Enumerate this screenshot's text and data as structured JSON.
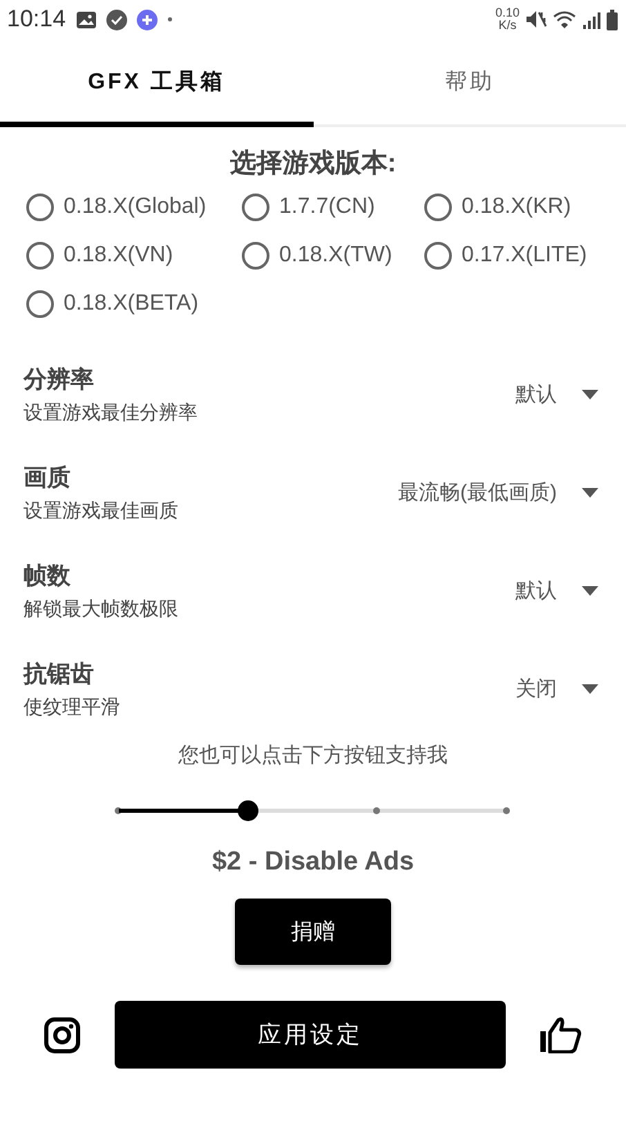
{
  "status_bar": {
    "time": "10:14",
    "net_speed": "0.10",
    "net_unit": "K/s"
  },
  "tabs": [
    {
      "label": "GFX 工具箱",
      "selected": true
    },
    {
      "label": "帮助",
      "selected": false
    }
  ],
  "version_picker": {
    "title": "选择游戏版本:",
    "options": [
      {
        "label": "0.18.X(Global)",
        "selected": false
      },
      {
        "label": "1.7.7(CN)",
        "selected": false
      },
      {
        "label": "0.18.X(KR)",
        "selected": false
      },
      {
        "label": "0.18.X(VN)",
        "selected": false
      },
      {
        "label": "0.18.X(TW)",
        "selected": false
      },
      {
        "label": "0.17.X(LITE)",
        "selected": false
      },
      {
        "label": "0.18.X(BETA)",
        "selected": false
      }
    ]
  },
  "settings": [
    {
      "title": "分辨率",
      "subtitle": "设置游戏最佳分辨率",
      "value": "默认"
    },
    {
      "title": "画质",
      "subtitle": "设置游戏最佳画质",
      "value": "最流畅(最低画质)"
    },
    {
      "title": "帧数",
      "subtitle": "解锁最大帧数极限",
      "value": "默认"
    },
    {
      "title": "抗锯齿",
      "subtitle": "使纹理平滑",
      "value": "关闭"
    }
  ],
  "support": {
    "text": "您也可以点击下方按钮支持我",
    "slider": {
      "level": 0.333
    },
    "price": "$2 - Disable Ads",
    "donate_button": "捐赠"
  },
  "apply_button": "应用设定"
}
